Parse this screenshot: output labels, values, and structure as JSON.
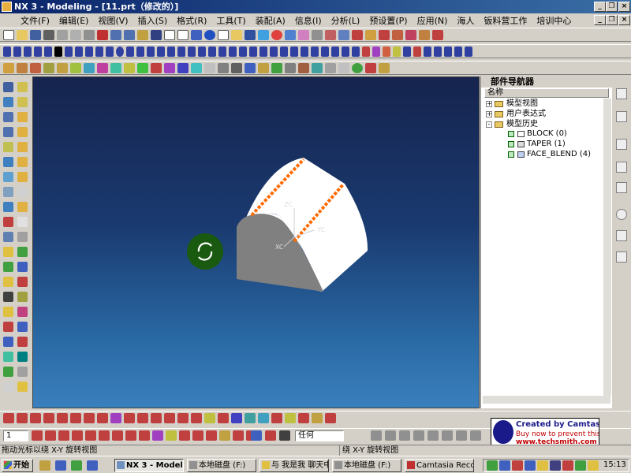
{
  "window": {
    "title": "NX 3 - Modeling - [11.prt（修改的）]",
    "min_label": "_",
    "restore_label": "❐",
    "close_label": "×"
  },
  "menu": {
    "items": [
      "文件(F)",
      "编辑(E)",
      "视图(V)",
      "插入(S)",
      "格式(R)",
      "工具(T)",
      "装配(A)",
      "信息(I)",
      "分析(L)",
      "预设置(P)",
      "应用(N)",
      "海人",
      "钣料营工作",
      "培训中心"
    ],
    "doc_min_label": "_",
    "doc_restore_label": "❐",
    "doc_close_label": "×"
  },
  "viewport": {
    "axis_zc": "ZC",
    "axis_yc": "YC",
    "axis_xc": "XC",
    "rotate_icon": "rotate-icon"
  },
  "navigator": {
    "title": "部件导航器",
    "column_name": "名称",
    "tree": [
      {
        "label": "模型视图",
        "expander": "+"
      },
      {
        "label": "用户表达式",
        "expander": "+"
      },
      {
        "label": "模型历史",
        "expander": "-"
      }
    ],
    "features": [
      {
        "label": "BLOCK (0)",
        "num": "1"
      },
      {
        "label": "TAPER (1)",
        "num": "1"
      },
      {
        "label": "FACE_BLEND (4)",
        "num": "1"
      }
    ]
  },
  "toolbar": {
    "layer_value": "1",
    "filter_value": "任何"
  },
  "status": {
    "left": "拖动光标以绕 X-Y 旋转视图",
    "right": "绕 X-Y 旋转视图"
  },
  "taskbar": {
    "start": "开始",
    "tasks": [
      "NX 3 - Modeling ...",
      "本地磁盘 (F:)",
      "与 我是我 聊天中",
      "本地磁盘 (F:)",
      "Camtasia Recor..."
    ],
    "clock": "15:13"
  },
  "watermark": {
    "line1": "Created by Camtasia",
    "line2": "Buy now to prevent this tag",
    "line3": "www.techsmith.com"
  },
  "colors": {
    "accent": "#0a246a",
    "model": "#ffffff",
    "edge_highlight": "#ff6a00"
  }
}
